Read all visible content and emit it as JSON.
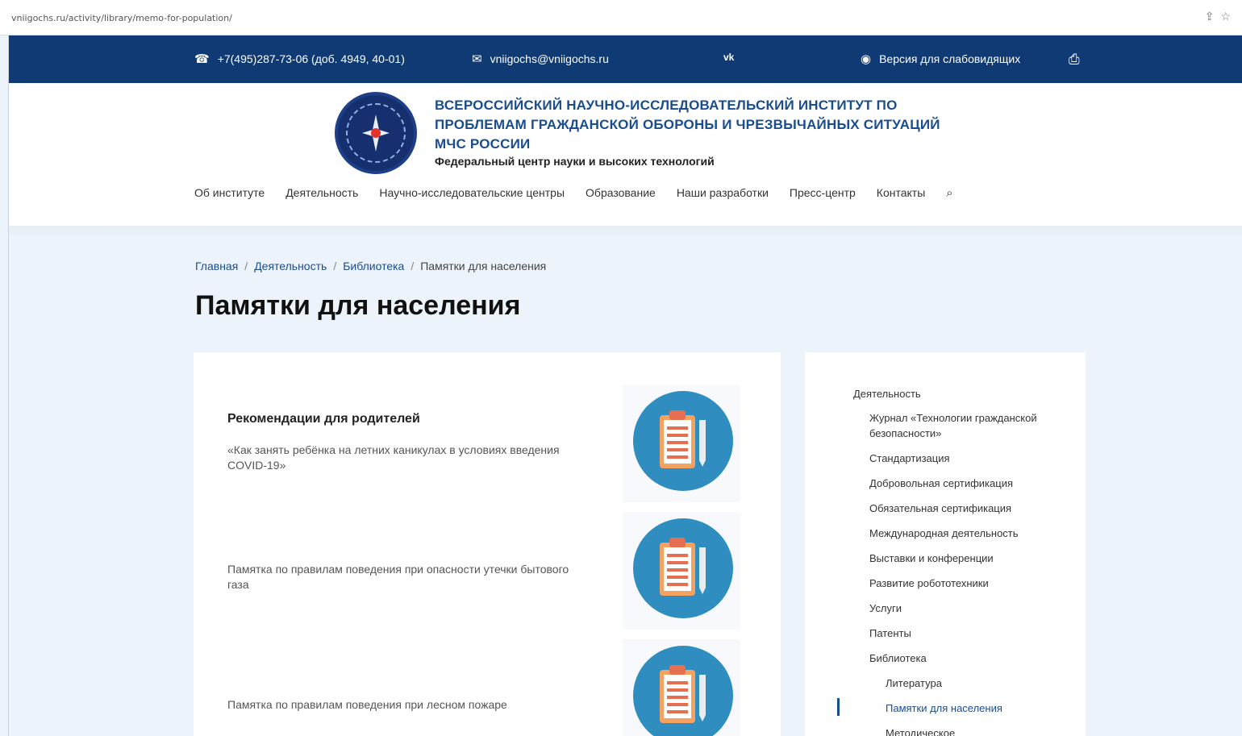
{
  "browser": {
    "url": "vniigochs.ru/activity/library/memo-for-population/",
    "icons": [
      "share-icon",
      "star-icon"
    ]
  },
  "topbar": {
    "phone": "+7(495)287-73-06 (доб. 4949, 40-01)",
    "email": "vniigochs@vniigochs.ru",
    "vk": "vk",
    "accessibility": "Версия для слабовидящих",
    "bg_color": "#0f3a73"
  },
  "header": {
    "org_title": "ВСЕРОССИЙСКИЙ НАУЧНО-ИССЛЕДОВАТЕЛЬСКИЙ ИНСТИТУТ ПО ПРОБЛЕМАМ ГРАЖДАНСКОЙ ОБОРОНЫ И ЧРЕЗВЫЧАЙНЫХ СИТУАЦИЙ МЧС РОССИИ",
    "org_subtitle": "Федеральный центр науки и высоких технологий",
    "nav": [
      "Об институте",
      "Деятельность",
      "Научно-исследовательские центры",
      "Образование",
      "Наши разработки",
      "Пресс-центр",
      "Контакты"
    ]
  },
  "breadcrumbs": [
    "Главная",
    "Деятельность",
    "Библиотека",
    "Памятки для населения"
  ],
  "page_title": "Памятки для населения",
  "memos": [
    {
      "title": "Рекомендации для родителей",
      "desc": "«Как занять ребёнка на летних каникулах в условиях введения COVID-19»"
    },
    {
      "title": "",
      "desc": "Памятка по правилам поведения при опасности утечки бытового газа"
    },
    {
      "title": "",
      "desc": "Памятка по правилам поведения при лесном пожаре"
    }
  ],
  "sidebar": {
    "root": "Деятельность",
    "items": [
      "Журнал «Технологии гражданской безопасности»",
      "Стандартизация",
      "Добровольная сертификация",
      "Обязательная сертификация",
      "Международная деятельность",
      "Выставки и конференции",
      "Развитие робототехники",
      "Услуги",
      "Патенты",
      "Библиотека"
    ],
    "sub_items": [
      "Литература",
      "Памятки для населения",
      "Методическое"
    ],
    "active": "Памятки для населения"
  }
}
